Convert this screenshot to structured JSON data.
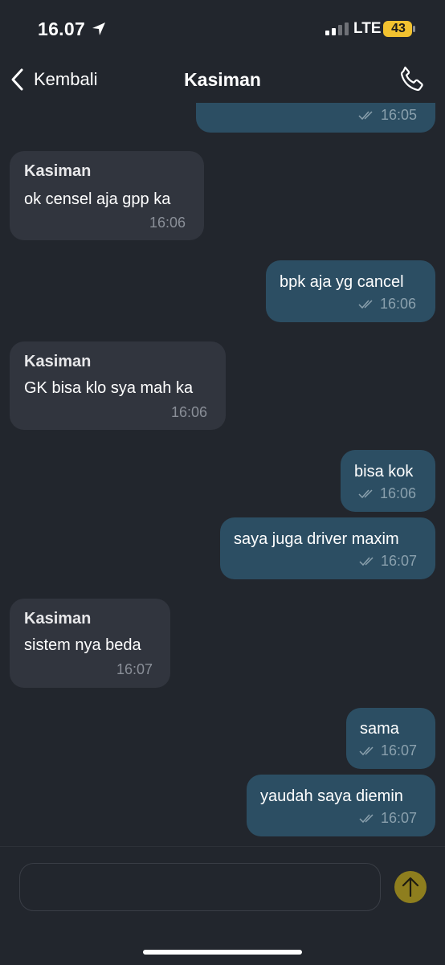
{
  "status_bar": {
    "time": "16.07",
    "network": "LTE",
    "battery": "43"
  },
  "nav": {
    "back_label": "Kembali",
    "title": "Kasiman"
  },
  "messages": [
    {
      "direction": "outgoing",
      "text": "",
      "time": "16:05"
    },
    {
      "direction": "incoming",
      "sender": "Kasiman",
      "text": "ok censel aja gpp ka",
      "time": "16:06"
    },
    {
      "direction": "outgoing",
      "text": "bpk aja yg cancel",
      "time": "16:06"
    },
    {
      "direction": "incoming",
      "sender": "Kasiman",
      "text": "GK bisa klo sya mah ka",
      "time": "16:06"
    },
    {
      "direction": "outgoing",
      "text": "bisa kok",
      "time": "16:06"
    },
    {
      "direction": "outgoing",
      "text": "saya juga driver maxim",
      "time": "16:07"
    },
    {
      "direction": "incoming",
      "sender": "Kasiman",
      "text": "sistem nya beda",
      "time": "16:07"
    },
    {
      "direction": "outgoing",
      "text": "sama",
      "time": "16:07"
    },
    {
      "direction": "outgoing",
      "text": "yaudah saya diemin",
      "time": "16:07"
    }
  ],
  "colors": {
    "background": "#22262d",
    "incoming_bubble": "#31353e",
    "outgoing_bubble": "#2c4e63",
    "send_button": "#8e7e1e",
    "battery": "#f2c230"
  },
  "icons": {
    "back": "chevron-left-icon",
    "call": "phone-icon",
    "send": "arrow-up-icon",
    "location": "location-arrow-icon",
    "read": "double-check-icon"
  }
}
